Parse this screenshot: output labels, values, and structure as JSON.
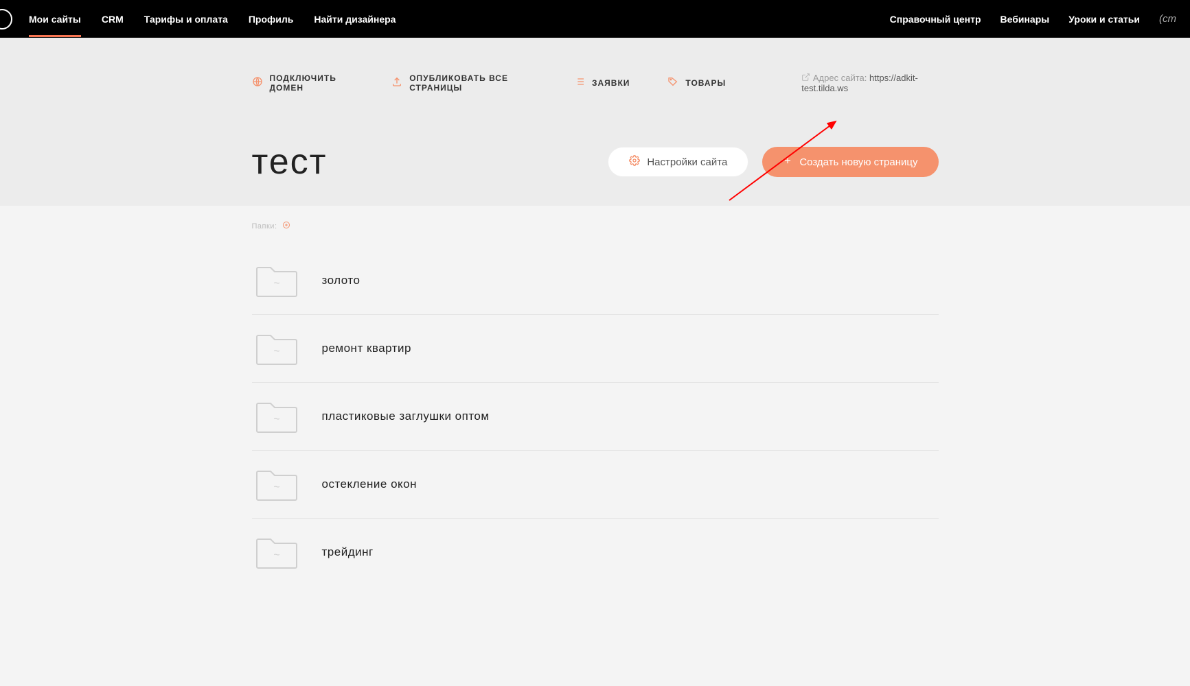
{
  "colors": {
    "accent": "#f5926d",
    "accent_dark": "#f87552"
  },
  "nav": {
    "left_items": [
      {
        "label": "Мои сайты",
        "active": true
      },
      {
        "label": "CRM",
        "active": false
      },
      {
        "label": "Тарифы и оплата",
        "active": false
      },
      {
        "label": "Профиль",
        "active": false
      },
      {
        "label": "Найти дизайнера",
        "active": false
      }
    ],
    "right_items": [
      {
        "label": "Справочный центр"
      },
      {
        "label": "Вебинары"
      },
      {
        "label": "Уроки и статьи"
      }
    ],
    "cmd_fragment": "(cm"
  },
  "toolbar": {
    "connect_domain": "ПОДКЛЮЧИТЬ ДОМЕН",
    "publish_all": "ОПУБЛИКОВАТЬ ВСЕ СТРАНИЦЫ",
    "requests": "ЗАЯВКИ",
    "products": "ТОВАРЫ"
  },
  "site_address": {
    "label": "Адрес сайта:",
    "url": "https://adkit-test.tilda.ws"
  },
  "page": {
    "title": "тест"
  },
  "buttons": {
    "settings": "Настройки сайта",
    "create_page": "Создать новую страницу"
  },
  "folders": {
    "label": "Папки:",
    "items": [
      {
        "name": "золото"
      },
      {
        "name": "ремонт квартир"
      },
      {
        "name": "пластиковые заглушки оптом"
      },
      {
        "name": "остекление окон"
      },
      {
        "name": "трейдинг"
      }
    ]
  }
}
